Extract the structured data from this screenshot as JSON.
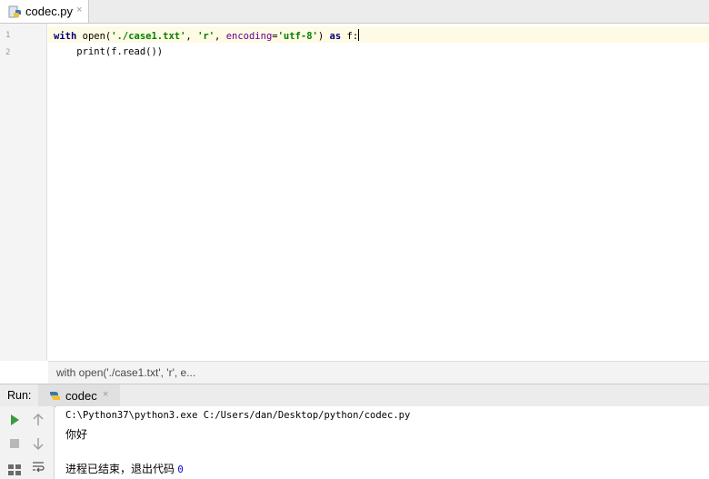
{
  "editor_tab": {
    "filename": "codec.py",
    "close_glyph": "×"
  },
  "gutter": {
    "lines": [
      "1",
      "2"
    ]
  },
  "code": {
    "line1": {
      "kw_with": "with",
      "fn_open": "open(",
      "path": "'./case1.txt'",
      "sep1": ", ",
      "mode": "'r'",
      "sep2": ", ",
      "param": "encoding",
      "eq": "=",
      "enc": "'utf-8'",
      "close": ")",
      "kw_as": "as",
      "var": "f",
      "colon": ":"
    },
    "line2": {
      "text": "    print(f.read())"
    }
  },
  "breadcrumb": {
    "text": "with open('./case1.txt', 'r', e..."
  },
  "run_panel": {
    "title": "Run:",
    "tab_label": "codec",
    "close_glyph": "×",
    "output": {
      "command": "C:\\Python37\\python3.exe C:/Users/dan/Desktop/python/codec.py",
      "result": "你好",
      "exit_message": "进程已结束，退出代码 ",
      "exit_code": "0"
    },
    "toolbar_icons": [
      "play-icon",
      "stop-icon",
      "up-arrow-icon",
      "down-arrow-icon",
      "layout-icon",
      "soft-wrap-icon"
    ]
  },
  "colors": {
    "keyword": "#000080",
    "string": "#008000",
    "param": "#660099",
    "run": "#3c9a3c",
    "current_line": "#fffae3"
  }
}
